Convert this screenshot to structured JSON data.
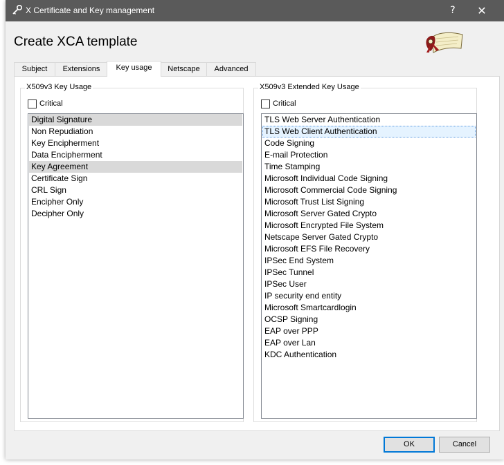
{
  "window": {
    "title": "X Certificate and Key management",
    "help_glyph": "?",
    "close_glyph": "✕"
  },
  "heading": "Create XCA template",
  "tabs": [
    {
      "label": "Subject"
    },
    {
      "label": "Extensions"
    },
    {
      "label": "Key usage",
      "active": true
    },
    {
      "label": "Netscape"
    },
    {
      "label": "Advanced"
    }
  ],
  "key_usage": {
    "group_title": "X509v3 Key Usage",
    "critical_label": "Critical",
    "critical_checked": false,
    "items": [
      {
        "label": "Digital Signature",
        "selected": true
      },
      {
        "label": "Non Repudiation",
        "selected": false
      },
      {
        "label": "Key Encipherment",
        "selected": false
      },
      {
        "label": "Data Encipherment",
        "selected": false
      },
      {
        "label": "Key Agreement",
        "selected": true
      },
      {
        "label": "Certificate Sign",
        "selected": false
      },
      {
        "label": "CRL Sign",
        "selected": false
      },
      {
        "label": "Encipher Only",
        "selected": false
      },
      {
        "label": "Decipher Only",
        "selected": false
      }
    ]
  },
  "extended_key_usage": {
    "group_title": "X509v3 Extended Key Usage",
    "critical_label": "Critical",
    "critical_checked": false,
    "items": [
      {
        "label": "TLS Web Server Authentication"
      },
      {
        "label": "TLS Web Client Authentication",
        "focused": true
      },
      {
        "label": "Code Signing"
      },
      {
        "label": "E-mail Protection"
      },
      {
        "label": "Time Stamping"
      },
      {
        "label": "Microsoft Individual Code Signing"
      },
      {
        "label": "Microsoft Commercial Code Signing"
      },
      {
        "label": "Microsoft Trust List Signing"
      },
      {
        "label": "Microsoft Server Gated Crypto"
      },
      {
        "label": "Microsoft Encrypted File System"
      },
      {
        "label": "Netscape Server Gated Crypto"
      },
      {
        "label": "Microsoft EFS File Recovery"
      },
      {
        "label": "IPSec End System"
      },
      {
        "label": "IPSec Tunnel"
      },
      {
        "label": "IPSec User"
      },
      {
        "label": "IP security end entity"
      },
      {
        "label": "Microsoft Smartcardlogin"
      },
      {
        "label": "OCSP Signing"
      },
      {
        "label": "EAP over PPP"
      },
      {
        "label": "EAP over Lan"
      },
      {
        "label": "KDC Authentication"
      }
    ]
  },
  "buttons": {
    "ok": "OK",
    "cancel": "Cancel"
  },
  "colors": {
    "titlebar": "#5a5a5a",
    "selection": "#d9d9d9",
    "focus_accent": "#0078d7"
  }
}
